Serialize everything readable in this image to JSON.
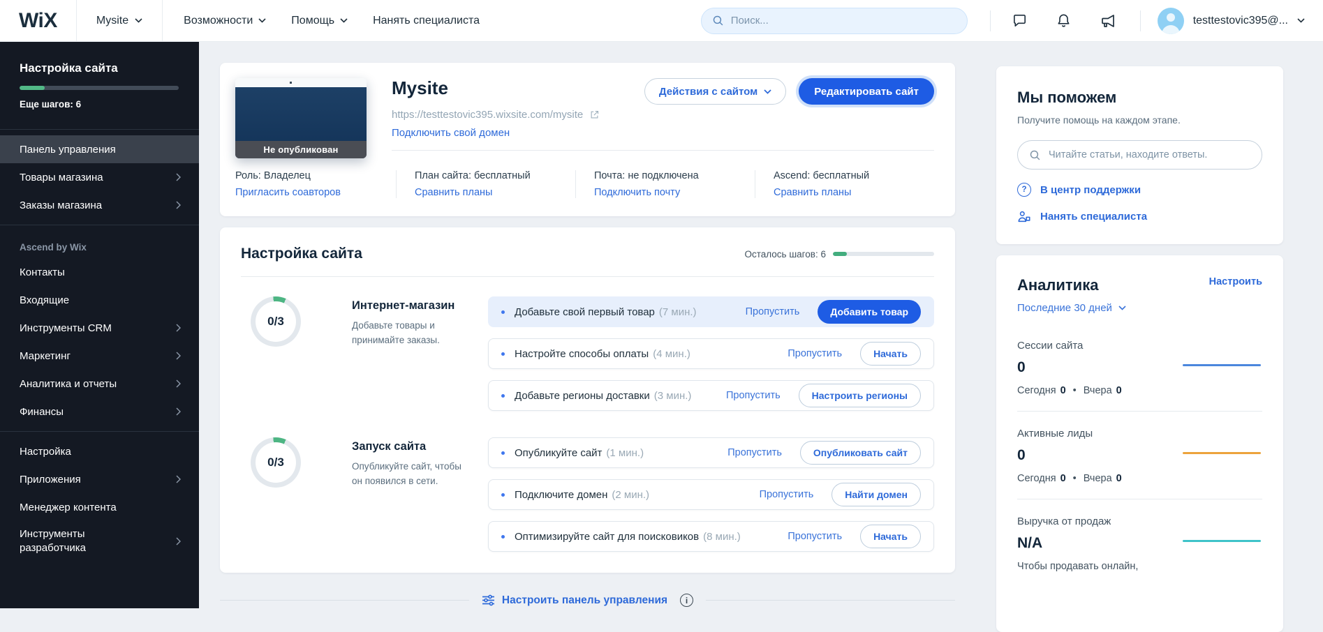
{
  "topbar": {
    "logo": "WiX",
    "site_menu": "Mysite",
    "nav": [
      {
        "label": "Возможности"
      },
      {
        "label": "Помощь"
      },
      {
        "label": "Нанять специалиста"
      }
    ],
    "search_placeholder": "Поиск...",
    "account_email": "testtestovic395@..."
  },
  "sidebar": {
    "setup_title": "Настройка сайта",
    "steps_left": "Еще шагов: 6",
    "section_label": "Ascend by Wix",
    "items": [
      {
        "label": "Панель управления"
      },
      {
        "label": "Товары магазина"
      },
      {
        "label": "Заказы магазина"
      },
      {
        "label": "Контакты"
      },
      {
        "label": "Входящие"
      },
      {
        "label": "Инструменты CRM"
      },
      {
        "label": "Маркетинг"
      },
      {
        "label": "Аналитика и отчеты"
      },
      {
        "label": "Финансы"
      },
      {
        "label": "Настройка"
      },
      {
        "label": "Приложения"
      },
      {
        "label": "Менеджер контента"
      },
      {
        "label": "Инструменты разработчика"
      }
    ]
  },
  "site_card": {
    "title": "Mysite",
    "url": "https://testtestovic395.wixsite.com/mysite",
    "connect_domain_link": "Подключить свой домен",
    "thumbnail_badge": "Не опубликован",
    "actions_button": "Действия с сайтом",
    "edit_button": "Редактировать сайт",
    "info": [
      {
        "label": "Роль: Владелец",
        "link": "Пригласить соавторов"
      },
      {
        "label": "План сайта: бесплатный",
        "link": "Сравнить планы"
      },
      {
        "label": "Почта: не подключена",
        "link": "Подключить почту"
      },
      {
        "label": "Ascend: бесплатный",
        "link": "Сравнить планы"
      }
    ]
  },
  "setup_card": {
    "title": "Настройка сайта",
    "steps_left": "Осталось шагов: 6",
    "sections": [
      {
        "progress": "0/3",
        "title": "Интернет-магазин",
        "desc": "Добавьте товары и принимайте заказы.",
        "tasks": [
          {
            "label": "Добавьте свой первый товар",
            "time": "(7 мин.)",
            "skip": "Пропустить",
            "action": "Добавить товар"
          },
          {
            "label": "Настройте способы оплаты",
            "time": "(4 мин.)",
            "skip": "Пропустить",
            "action": "Начать"
          },
          {
            "label": "Добавьте регионы доставки",
            "time": "(3 мин.)",
            "skip": "Пропустить",
            "action": "Настроить регионы"
          }
        ]
      },
      {
        "progress": "0/3",
        "title": "Запуск сайта",
        "desc": "Опубликуйте сайт, чтобы он появился в сети.",
        "tasks": [
          {
            "label": "Опубликуйте сайт",
            "time": "(1 мин.)",
            "skip": "Пропустить",
            "action": "Опубликовать сайт"
          },
          {
            "label": "Подключите домен",
            "time": "(2 мин.)",
            "skip": "Пропустить",
            "action": "Найти домен"
          },
          {
            "label": "Оптимизируйте сайт для поисковиков",
            "time": "(8 мин.)",
            "skip": "Пропустить",
            "action": "Начать"
          }
        ]
      }
    ],
    "customize_label": "Настроить панель управления"
  },
  "help_card": {
    "title": "Мы поможем",
    "subtitle": "Получите помощь на каждом этапе.",
    "search_placeholder": "Читайте статьи, находите ответы.",
    "support_link": "В центр поддержки",
    "hire_link": "Нанять специалиста",
    "question_mark": "?"
  },
  "analytics_card": {
    "title": "Аналитика",
    "configure_link": "Настроить",
    "period": "Последние 30 дней",
    "metrics": [
      {
        "label": "Сессии сайта",
        "value": "0",
        "today_label": "Сегодня",
        "today_value": "0",
        "separator": "•",
        "yesterday_label": "Вчера",
        "yesterday_value": "0",
        "spark_color": "#4b87dd"
      },
      {
        "label": "Активные лиды",
        "value": "0",
        "today_label": "Сегодня",
        "today_value": "0",
        "separator": "•",
        "yesterday_label": "Вчера",
        "yesterday_value": "0",
        "spark_color": "#eca33c"
      },
      {
        "label": "Выручка от продаж",
        "value": "N/A",
        "note": "Чтобы продавать онлайн,",
        "spark_color": "#3fc3c9"
      }
    ]
  },
  "colors": {
    "primary_button_blue": "#1e5ce4",
    "link_blue": "#2e6ad9",
    "progress_green": "#4db583",
    "spark_blue": "#4b87dd",
    "spark_orange": "#eca33c",
    "spark_teal": "#3fc3c9",
    "sidebar_bg": "#141923",
    "highlight_row": "#e7effc"
  }
}
